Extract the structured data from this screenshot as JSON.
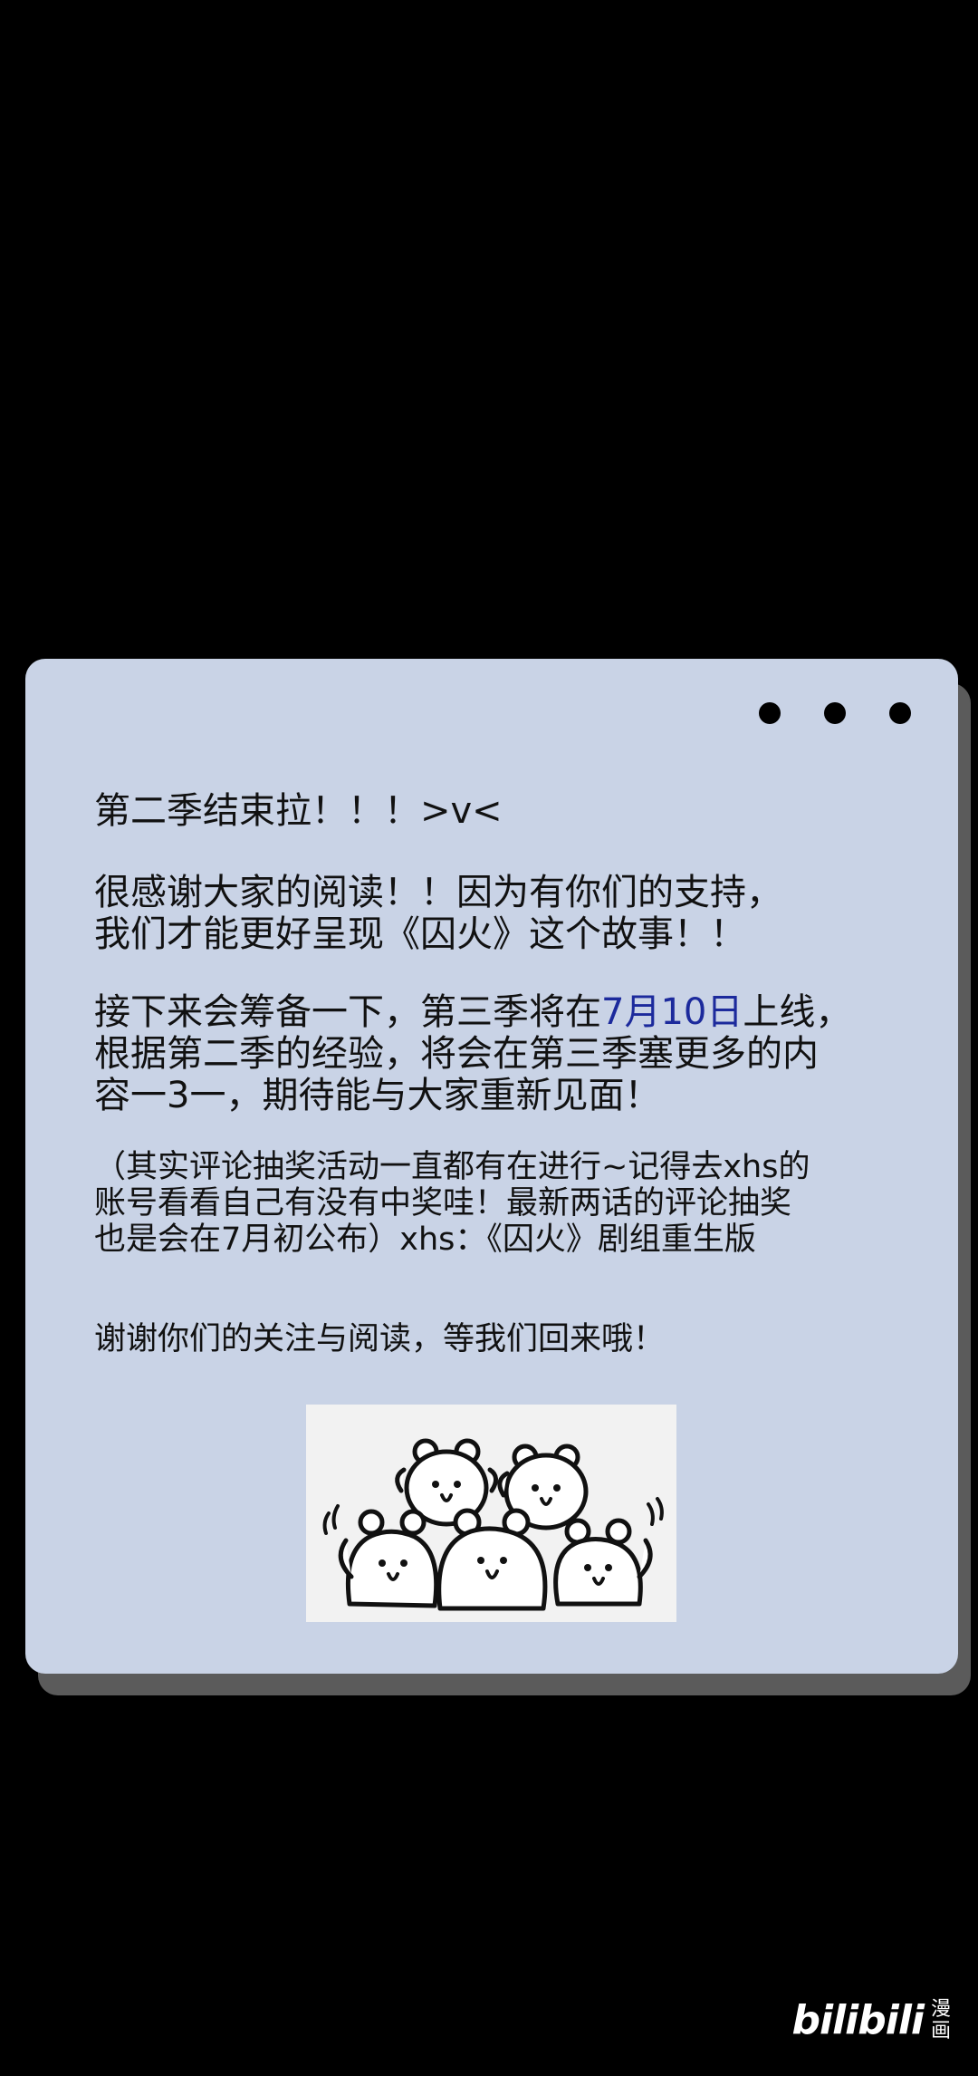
{
  "card": {
    "p1": "第二季结束拉！！！>v<",
    "p2_line1": "很感谢大家的阅读！！因为有你们的支持，",
    "p2_line2": "我们才能更好呈现《囚火》这个故事！！",
    "p3_line1_before": "接下来会筹备一下，第三季将在",
    "p3_date": "7月10日",
    "p3_line1_after": "上线，",
    "p3_line2": "根据第二季的经验，将会在第三季塞更多的内",
    "p3_line3": "容一3一，期待能与大家重新见面！",
    "p4_line1": "（其实评论抽奖活动一直都有在进行~记得去xhs的",
    "p4_line2": "账号看看自己有没有中奖哇！最新两话的评论抽奖",
    "p4_line3": "也是会在7月初公布）xhs：《囚火》剧组重生版",
    "p5": "谢谢你们的关注与阅读，等我们回来哦！"
  },
  "colors": {
    "background": "#000000",
    "card": "#c9d3e6",
    "card_shadow": "#5b5b5b",
    "date_highlight": "#1c2a9c"
  },
  "icons": {
    "window_dots": [
      "dot",
      "dot",
      "dot"
    ],
    "sticker": "cheering-bears-sticker"
  },
  "watermark": {
    "brand": "bilibili",
    "sub": "漫画"
  }
}
